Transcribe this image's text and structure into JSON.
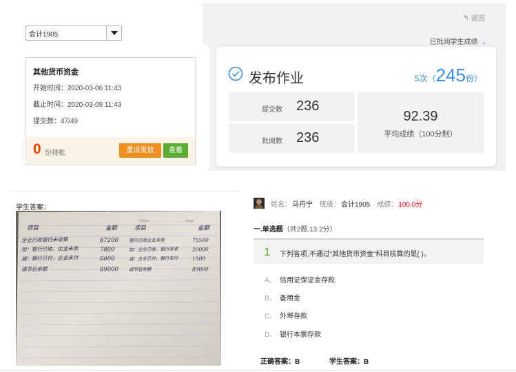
{
  "class_select": {
    "value": "会计1905"
  },
  "task_card": {
    "name": "其他货币资金",
    "start_time": "开始时间：2020-03-06 11:43",
    "end_time": "截止时间：2020-03-09 11:43",
    "submitted": "提交数：47/49",
    "pending_count": "0",
    "pending_label": "份待批",
    "reset_button": "重设发放",
    "view_button": "查看"
  },
  "right_panel": {
    "back_label": "返回",
    "reviewed_link": "已批阅学生成绩",
    "publish_title": "发布作业",
    "times_count": "5",
    "times_unit": "次（",
    "copies_count": "245",
    "copies_unit": "份）",
    "submit_label": "提交数",
    "submit_value": "236",
    "review_label": "批阅数",
    "review_value": "236",
    "avg_value": "92.39",
    "avg_label": "平均成绩（100分制）"
  },
  "answer_panel": {
    "title": "学生答案：",
    "photo": {
      "date_label": "Date:",
      "page_label": "Page",
      "rows": [
        [
          "项目",
          "金额",
          "项目",
          "金额"
        ],
        [
          "企业已收银行未收银",
          "87200",
          "银行已收企业未收",
          "75500"
        ],
        [
          "加：银行已收，企业未收",
          "7800",
          "加：企业已收，银行未收",
          "20000"
        ],
        [
          "减：银行已付，企业未付",
          "6000",
          "减：企业已付，银行未付",
          "1500"
        ],
        [
          "调节后余额",
          "89000",
          "调节后余额",
          "89000"
        ]
      ]
    }
  },
  "student": {
    "name_label": "姓名：",
    "name": "马丹宁",
    "class_label": "班级：",
    "class": "会计1905",
    "score_label": "成绩：",
    "score": "100.0分"
  },
  "section": {
    "title": "一.单选题",
    "sub": "（共2题,13.2分）"
  },
  "question": {
    "number": "1",
    "text": "下列各项,不通过“其他货币资金”科目核算的是( )。",
    "options": [
      {
        "letter": "A、",
        "text": "信用证保证金存款"
      },
      {
        "letter": "B、",
        "text": "备用金"
      },
      {
        "letter": "C、",
        "text": "外埠存款"
      },
      {
        "letter": "D、",
        "text": "银行本票存款"
      }
    ],
    "correct_label": "正确答案：",
    "correct": "B",
    "student_label": "学生答案：",
    "student_answer": "B"
  },
  "colors": {
    "accent_blue": "#3a8ee6",
    "pending_red": "#ff3c00",
    "button_orange": "#ef8f1f",
    "button_green": "#5aad32",
    "score_red": "#ff0000"
  }
}
